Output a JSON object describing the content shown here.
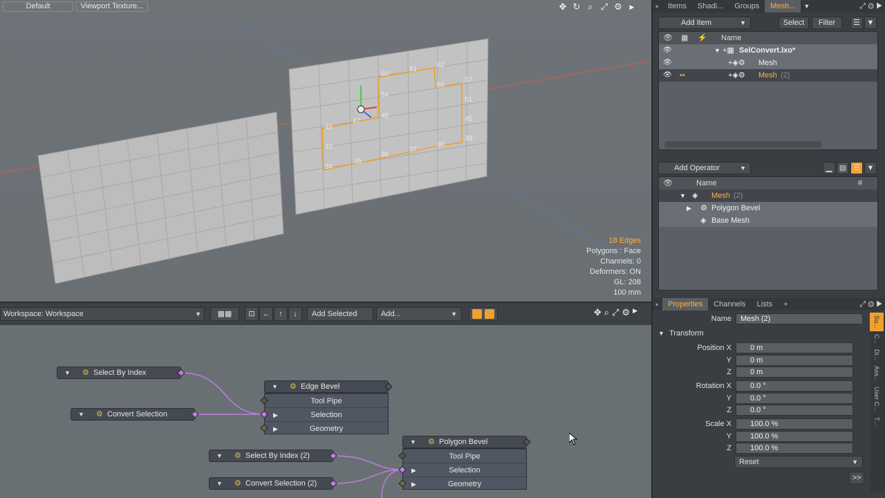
{
  "viewport": {
    "preset_label": "Default",
    "shading_label": "Viewport Texture...",
    "hud": {
      "edges": "18 Edges",
      "polygons": "Polygons : Face",
      "channels": "Channels: 0",
      "deformers": "Deformers: ON",
      "gl": "GL: 208",
      "units": "100 mm"
    },
    "vertex_labels": [
      "60",
      "61",
      "62",
      "57",
      "54",
      "56",
      "51",
      "48",
      "47",
      "45",
      "46",
      "40",
      "39",
      "38",
      "37",
      "36",
      "35",
      "34"
    ]
  },
  "schematic_toolbar": {
    "workspace": "Workspace: Workspace",
    "add_selected": "Add Selected",
    "add": "Add..."
  },
  "nodes": [
    {
      "title": "Select By Index",
      "type": "small"
    },
    {
      "title": "Convert Selection",
      "type": "small"
    },
    {
      "title": "Edge Bevel",
      "ports": [
        "Tool Pipe",
        "Selection",
        "Geometry"
      ]
    },
    {
      "title": "Select By Index (2)",
      "type": "small"
    },
    {
      "title": "Convert Selection (2)",
      "type": "small"
    },
    {
      "title": "Polygon Bevel",
      "ports": [
        "Tool Pipe",
        "Selection",
        "Geometry"
      ]
    }
  ],
  "items_panel": {
    "tabs": [
      "Items",
      "Shadi...",
      "Groups",
      "Mesh..."
    ],
    "add_item": "Add Item",
    "select": "Select",
    "filter": "Filter",
    "name_header": "Name",
    "rows": [
      {
        "label": "SelConvert.lxo*",
        "suffix": ""
      },
      {
        "label": "Mesh",
        "suffix": ""
      },
      {
        "label": "Mesh",
        "suffix": "(2)"
      }
    ]
  },
  "operator_panel": {
    "add_operator": "Add Operator",
    "name_header": "Name",
    "hash_header": "#",
    "rows": [
      {
        "label": "Mesh",
        "suffix": "(2)"
      },
      {
        "label": "Polygon Bevel",
        "suffix": ""
      },
      {
        "label": "Base Mesh",
        "suffix": ""
      }
    ]
  },
  "properties": {
    "tabs": [
      "Properties",
      "Channels",
      "Lists",
      "+"
    ],
    "name_label": "Name",
    "name_value": "Mesh (2)",
    "section": "Transform",
    "position_x_label": "Position X",
    "rotation_x_label": "Rotation X",
    "scale_x_label": "Scale X",
    "y_label": "Y",
    "z_label": "Z",
    "position": [
      "0 m",
      "0 m",
      "0 m"
    ],
    "rotation": [
      "0.0 °",
      "0.0 °",
      "0.0 °"
    ],
    "scale": [
      "100.0 %",
      "100.0 %",
      "100.0 %"
    ],
    "reset": "Reset",
    "more": ">>",
    "side_tabs": [
      "Su...",
      "C...",
      "Di...",
      "Ass...",
      "User C...",
      "T..."
    ]
  },
  "colors": {
    "accent": "#ffb040",
    "viewport_bg": "#6e7378",
    "node_header": "#454a52",
    "wire": "#c07de0"
  }
}
